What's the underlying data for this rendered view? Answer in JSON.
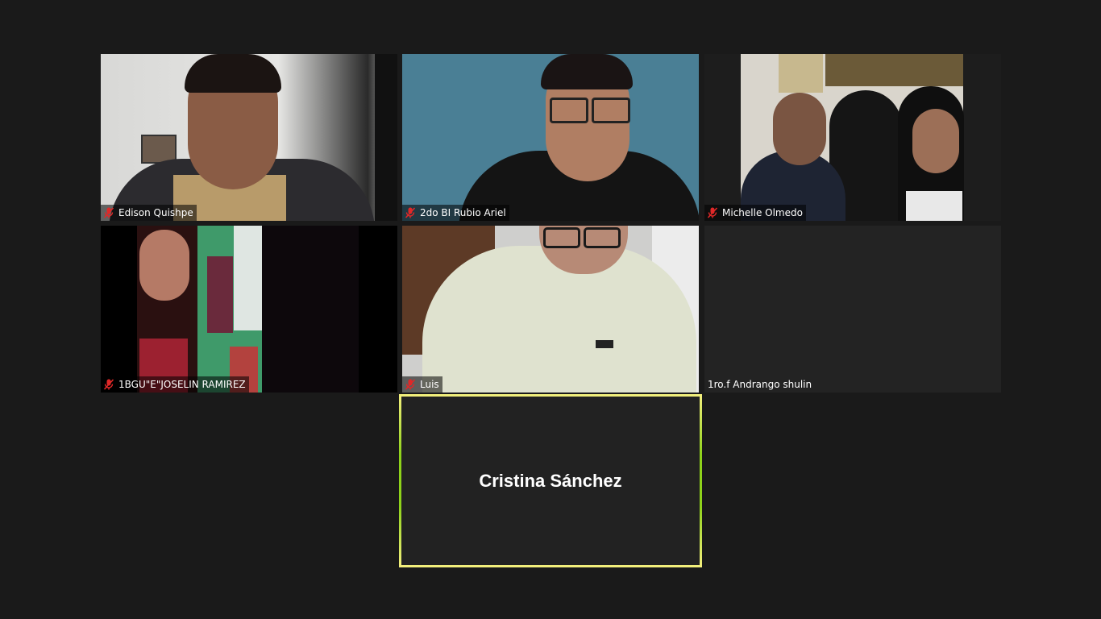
{
  "participants": [
    {
      "name": "Edison Quishpe",
      "muted": true
    },
    {
      "name": "2do BI Rubio Ariel",
      "muted": true
    },
    {
      "name": "Michelle Olmedo",
      "muted": true
    },
    {
      "name": "1BGU\"E\"JOSELIN RAMIREZ",
      "muted": true
    },
    {
      "name": "Luis",
      "muted": true
    },
    {
      "name": "1ro.f Andrango shulin",
      "muted": false
    }
  ],
  "active_speaker": {
    "name": "Cristina Sánchez"
  },
  "icons": {
    "mute": "microphone-muted-icon"
  },
  "colors": {
    "background": "#1a1a1a",
    "tile": "#232323",
    "mute_red": "#e02828",
    "speaker_border_green": "#8ed21a",
    "speaker_border_yellow": "#f2ef7c"
  }
}
